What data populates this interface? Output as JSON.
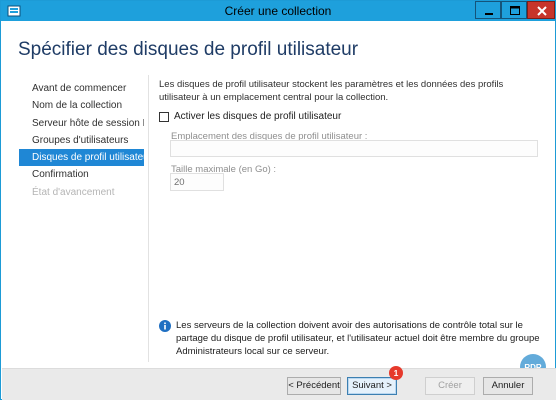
{
  "window": {
    "title": "Créer une collection"
  },
  "page": {
    "title": "Spécifier des disques de profil utilisateur"
  },
  "nav": {
    "items": [
      {
        "label": "Avant de commencer",
        "state": "normal"
      },
      {
        "label": "Nom de la collection",
        "state": "normal"
      },
      {
        "label": "Serveur hôte de session B...",
        "state": "normal"
      },
      {
        "label": "Groupes d'utilisateurs",
        "state": "normal"
      },
      {
        "label": "Disques de profil utilisateur",
        "state": "active"
      },
      {
        "label": "Confirmation",
        "state": "normal"
      },
      {
        "label": "État d'avancement",
        "state": "disabled"
      }
    ]
  },
  "main": {
    "description": "Les disques de profil utilisateur stockent les paramètres et les données des profils utilisateur à un emplacement central pour la collection.",
    "enable_checkbox_label": "Activer les disques de profil utilisateur",
    "enable_checked": false,
    "location_label": "Emplacement des disques de profil utilisateur :",
    "location_value": "",
    "max_size_label": "Taille maximale (en Go) :",
    "max_size_value": "20",
    "info_text": "Les serveurs de la collection doivent avoir des autorisations de contrôle total sur le partage du disque de profil utilisateur, et l'utilisateur actuel doit être membre du groupe Administrateurs local sur ce serveur."
  },
  "footer": {
    "prev_label": "< Précédent",
    "next_label": "Suivant >",
    "create_label": "Créer",
    "cancel_label": "Annuler",
    "badge_count": "1"
  },
  "watermark": {
    "text": "RDR"
  },
  "colors": {
    "titlebar": "#1ea0dc",
    "accent": "#1f87d5",
    "close": "#c7352b",
    "heading": "#1f3c66",
    "badge": "#e63a2c"
  }
}
